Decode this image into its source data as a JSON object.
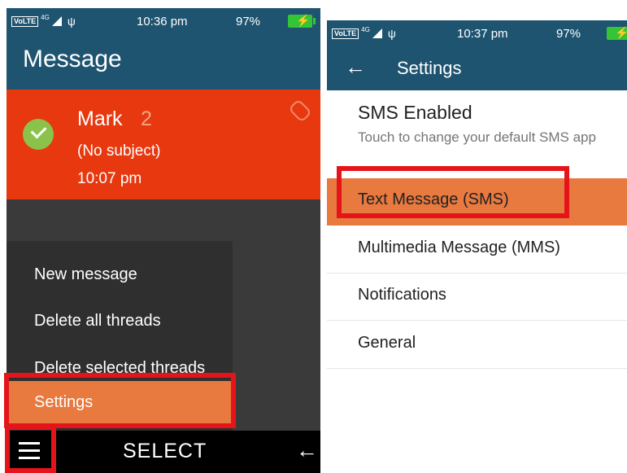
{
  "left_screen": {
    "status_bar": {
      "volte": "VoLTE",
      "network": "4G",
      "time": "10:36 pm",
      "battery_percent": "97%",
      "icons": [
        "signal-icon",
        "usb-icon",
        "battery-charging-icon"
      ]
    },
    "app_title": "Message",
    "thread": {
      "sender": "Mark",
      "count": "2",
      "subject": "(No subject)",
      "time": "10:07 pm",
      "icons": [
        "check-circle-icon",
        "attachment-icon"
      ]
    },
    "menu": {
      "items": [
        "New message",
        "Delete all threads",
        "Delete selected threads",
        "Settings"
      ]
    },
    "bottom_bar": {
      "center_label": "SELECT",
      "icons": [
        "hamburger-menu-icon",
        "back-arrow-icon"
      ]
    }
  },
  "right_screen": {
    "status_bar": {
      "volte": "VoLTE",
      "network": "4G",
      "time": "10:37 pm",
      "battery_percent": "97%"
    },
    "title": "Settings",
    "sms_enabled": {
      "title": "SMS Enabled",
      "subtitle": "Touch to change your default SMS app"
    },
    "items": [
      "Text Message (SMS)",
      "Multimedia Message (MMS)",
      "Notifications",
      "General"
    ]
  },
  "colors": {
    "app_bar": "#1e5470",
    "thread_bg": "#e8380f",
    "highlight": "#e8793f",
    "annotation": "#e5141b",
    "battery": "#35c435"
  }
}
